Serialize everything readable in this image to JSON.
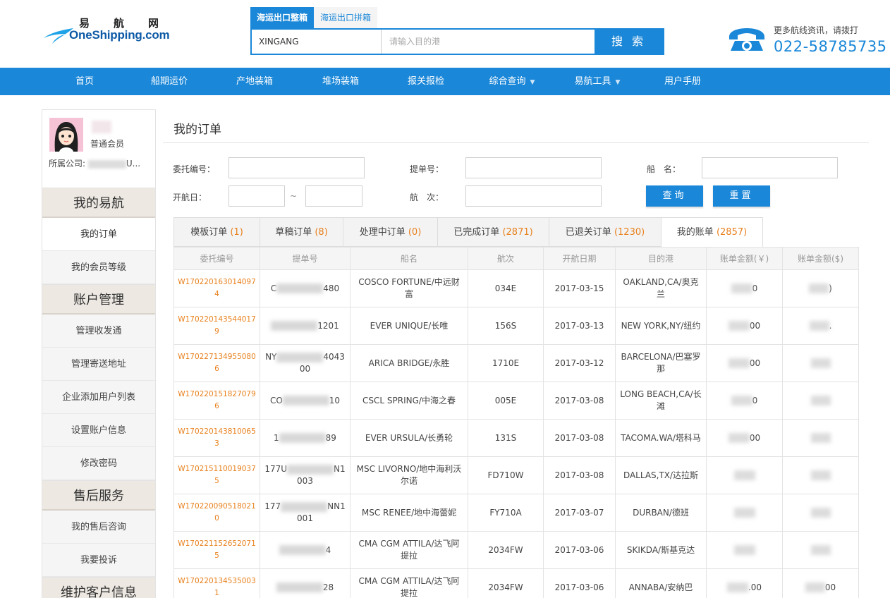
{
  "header": {
    "logo_cn": "易航网",
    "logo_en": "OneShipping.com",
    "search_tabs": [
      "海运出口整箱",
      "海运出口拼箱"
    ],
    "origin_value": "XINGANG",
    "dest_placeholder": "请输入目的港",
    "search_btn": "搜 索",
    "hotline_tip": "更多航线资讯，请拨打",
    "hotline_phone": "022-58785735"
  },
  "nav": [
    "首页",
    "船期运价",
    "产地装箱",
    "堆场装箱",
    "报关报检",
    "综合查询",
    "易航工具",
    "用户手册"
  ],
  "sidebar": {
    "member_level": "普通会员",
    "company_label": "所属公司:",
    "company_suffix": "U...",
    "sections": [
      {
        "title": "我的易航",
        "items": [
          "我的订单",
          "我的会员等级"
        ]
      },
      {
        "title": "账户管理",
        "items": [
          "管理收发通",
          "管理寄送地址",
          "企业添加用户列表",
          "设置账户信息",
          "修改密码"
        ]
      },
      {
        "title": "售后服务",
        "items": [
          "我的售后咨询",
          "我要投诉"
        ]
      },
      {
        "title": "维护客户信息",
        "items": []
      }
    ]
  },
  "main": {
    "title": "我的订单",
    "form": {
      "order_no": "委托编号：",
      "bl_no": "提单号：",
      "vessel": "船　名：",
      "etd": "开航日：",
      "tilde": "~",
      "voyage": "航　次：",
      "query": "查询",
      "reset": "重置"
    },
    "tabs": [
      {
        "label": "模板订单",
        "count": "(1)"
      },
      {
        "label": "草稿订单",
        "count": "(8)"
      },
      {
        "label": "处理中订单",
        "count": "(0)"
      },
      {
        "label": "已完成订单",
        "count": "(2871)"
      },
      {
        "label": "已退关订单",
        "count": "(1230)"
      },
      {
        "label": "我的账单",
        "count": "(2857)"
      }
    ],
    "columns": [
      "委托编号",
      "提单号",
      "船名",
      "航次",
      "开航日期",
      "目的港",
      "账单金额(￥)",
      "账单金额($)"
    ],
    "rows": [
      {
        "oid": "W1702201630140974",
        "bl_a": "C",
        "bl_b": "480",
        "vessel": "COSCO FORTUNE/中远财富",
        "voyage": "034E",
        "date": "2017-03-15",
        "dest": "OAKLAND,CA/奥克兰",
        "rmb": "0",
        "usd": ")"
      },
      {
        "oid": "W1702201435440179",
        "bl_a": "",
        "bl_b": "1201",
        "vessel": "EVER UNIQUE/长唯",
        "voyage": "156S",
        "date": "2017-03-13",
        "dest": "NEW YORK,NY/纽约",
        "rmb": "00",
        "usd": "."
      },
      {
        "oid": "W1702271349550806",
        "bl_a": "NY",
        "bl_b": "4043 00",
        "vessel": "ARICA BRIDGE/永胜",
        "voyage": "1710E",
        "date": "2017-03-12",
        "dest": "BARCELONA/巴塞罗那",
        "rmb": "00",
        "usd": ""
      },
      {
        "oid": "W1702201518270796",
        "bl_a": "CO",
        "bl_b": "10",
        "vessel": "CSCL SPRING/中海之春",
        "voyage": "005E",
        "date": "2017-03-08",
        "dest": "LONG BEACH,CA/长滩",
        "rmb": "0",
        "usd": ""
      },
      {
        "oid": "W1702201438100653",
        "bl_a": "1",
        "bl_b": "89",
        "vessel": "EVER URSULA/长勇轮",
        "voyage": "131S",
        "date": "2017-03-08",
        "dest": "TACOMA.WA/塔科马",
        "rmb": "00",
        "usd": ""
      },
      {
        "oid": "W1702151100190375",
        "bl_a": "177U",
        "bl_b": "N1 003",
        "vessel": "MSC LIVORNO/地中海利沃尔诺",
        "voyage": "FD710W",
        "date": "2017-03-08",
        "dest": "DALLAS,TX/达拉斯",
        "rmb": "",
        "usd": ""
      },
      {
        "oid": "W1702200905180210",
        "bl_a": "177",
        "bl_b": "NN1 001",
        "vessel": "MSC RENEE/地中海蕾妮",
        "voyage": "FY710A",
        "date": "2017-03-07",
        "dest": "DURBAN/德班",
        "rmb": "",
        "usd": ""
      },
      {
        "oid": "W1702211526520715",
        "bl_a": "",
        "bl_b": "4",
        "vessel": "CMA CGM ATTILA/达飞阿提拉",
        "voyage": "2034FW",
        "date": "2017-03-06",
        "dest": "SKIKDA/斯基克达",
        "rmb": "",
        "usd": ""
      },
      {
        "oid": "W1702201345350031",
        "bl_a": "",
        "bl_b": "28",
        "vessel": "CMA CGM ATTILA/达飞阿提拉",
        "voyage": "2034FW",
        "date": "2017-03-06",
        "dest": "ANNABA/安纳巴",
        "rmb": ".00",
        "usd": "00"
      }
    ]
  },
  "colors": {
    "primary": "#1a87d8",
    "accent": "#e8801c",
    "section_bg": "#ede8e2"
  }
}
